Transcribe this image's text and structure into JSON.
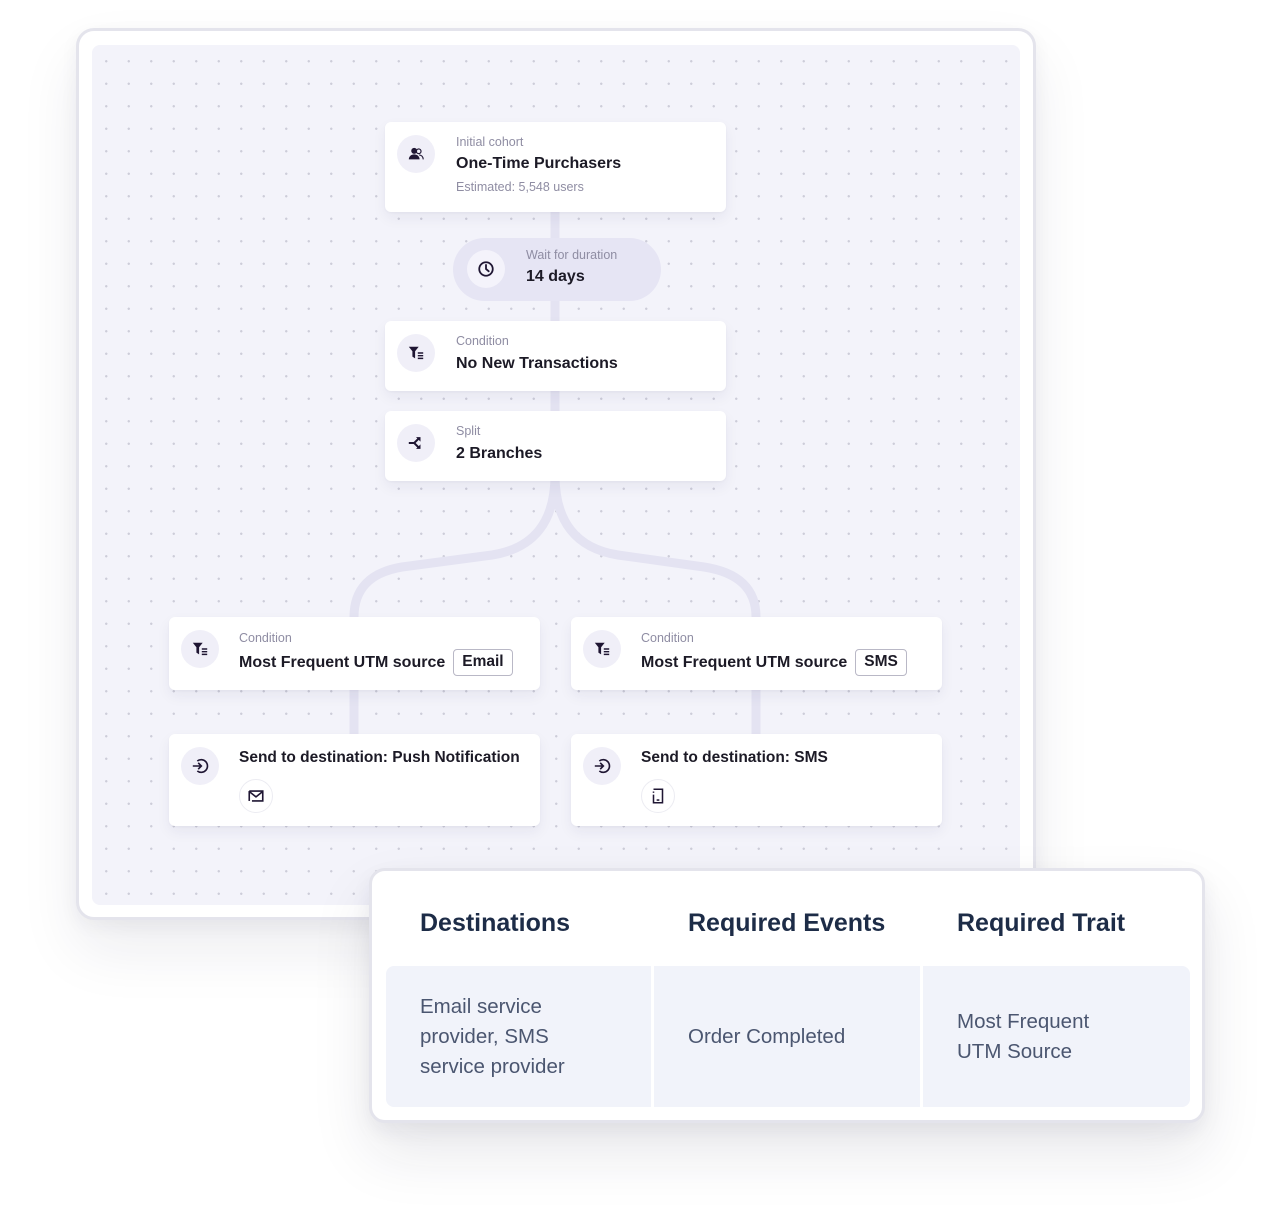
{
  "workflow": {
    "initial_cohort": {
      "kicker": "Initial cohort",
      "title": "One-Time Purchasers",
      "estimate": "Estimated: 5,548 users",
      "icon": "users-icon"
    },
    "wait": {
      "kicker": "Wait for duration",
      "title": "14 days",
      "icon": "clock-icon"
    },
    "condition": {
      "kicker": "Condition",
      "title": "No New Transactions",
      "icon": "filter-icon"
    },
    "split": {
      "kicker": "Split",
      "title": "2 Branches",
      "icon": "split-icon"
    },
    "branches": [
      {
        "condition": {
          "kicker": "Condition",
          "title": "Most Frequent UTM source",
          "tag": "Email",
          "icon": "filter-icon"
        },
        "destination": {
          "title": "Send to destination: Push Notification",
          "icon": "send-icon",
          "badge_icon": "mail-icon"
        }
      },
      {
        "condition": {
          "kicker": "Condition",
          "title": "Most Frequent UTM source",
          "tag": "SMS",
          "icon": "filter-icon"
        },
        "destination": {
          "title": "Send to destination: SMS",
          "icon": "send-icon",
          "badge_icon": "phone-icon"
        }
      }
    ]
  },
  "requirements_table": {
    "headers": [
      "Destinations",
      "Required Events",
      "Required Trait"
    ],
    "row": {
      "destinations": [
        "Email service",
        "provider, SMS",
        "service provider"
      ],
      "required_events": [
        "Order Completed"
      ],
      "required_trait": [
        "Most Frequent",
        "UTM Source"
      ]
    }
  },
  "colors": {
    "canvas_bg": "#f3f3fa",
    "connector": "#e4e3f2",
    "icon_bg": "#f0eff8",
    "icon_fg": "#1f1633",
    "table_header": "#1d2c47",
    "table_cell_bg": "#f1f3fa",
    "table_cell_text": "#4b5670"
  }
}
